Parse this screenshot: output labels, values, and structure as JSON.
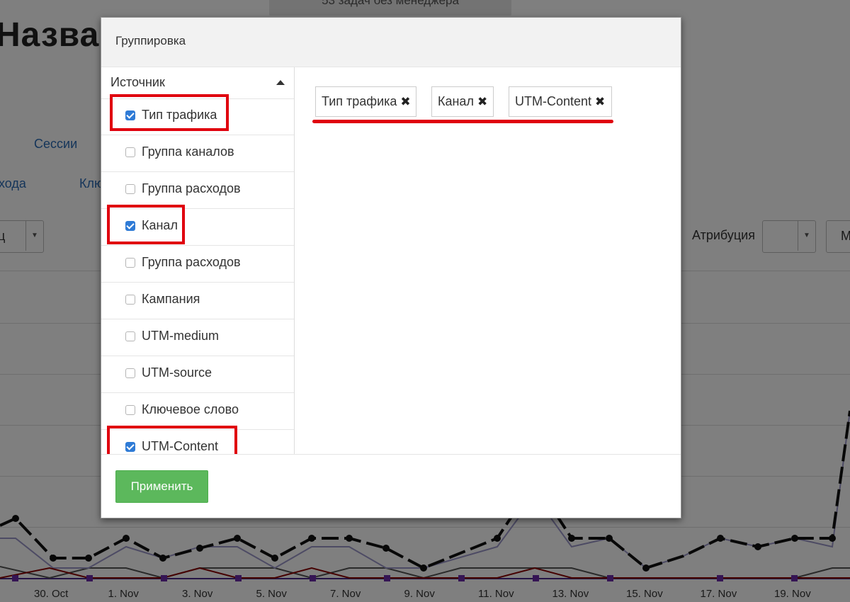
{
  "background": {
    "top_button": "53 задач без менеджера",
    "page_title": "Назва",
    "tabs": [
      "Сессии",
      "ходa",
      "Клю"
    ],
    "select_left_value": "ц",
    "attribution_label": "Атрибуция",
    "select_right_value": "М",
    "chart_x_labels": [
      "30. Oct",
      "1. Nov",
      "3. Nov",
      "5. Nov",
      "7. Nov",
      "9. Nov",
      "11. Nov",
      "13. Nov",
      "15. Nov",
      "17. Nov",
      "19. Nov"
    ]
  },
  "modal": {
    "title": "Группировка",
    "group_title": "Источник",
    "items": [
      {
        "label": "Тип трафика",
        "checked": true,
        "highlighted": true
      },
      {
        "label": "Группа каналов",
        "checked": false,
        "highlighted": false
      },
      {
        "label": "Группа расходов",
        "checked": false,
        "highlighted": false
      },
      {
        "label": "Канал",
        "checked": true,
        "highlighted": true
      },
      {
        "label": "Группа расходов",
        "checked": false,
        "highlighted": false
      },
      {
        "label": "Кампания",
        "checked": false,
        "highlighted": false
      },
      {
        "label": "UTM-medium",
        "checked": false,
        "highlighted": false
      },
      {
        "label": "UTM-source",
        "checked": false,
        "highlighted": false
      },
      {
        "label": "Ключевое слово",
        "checked": false,
        "highlighted": false
      },
      {
        "label": "UTM-Content",
        "checked": true,
        "highlighted": true
      }
    ],
    "selected_tags": [
      "Тип трафика",
      "Канал",
      "UTM-Content"
    ],
    "remove_glyph": "✖",
    "apply_label": "Применить"
  },
  "colors": {
    "highlight": "#e0000e",
    "checkbox": "#2f7bd6",
    "apply_button": "#5cb85c"
  }
}
